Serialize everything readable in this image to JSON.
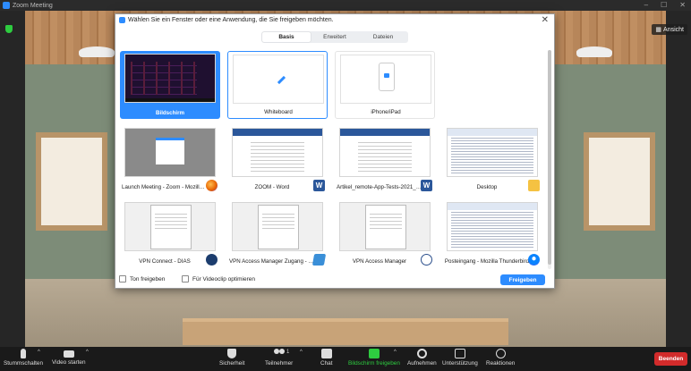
{
  "window": {
    "title": "Zoom Meeting",
    "controls": [
      "–",
      "☐",
      "✕"
    ]
  },
  "view_button": {
    "label": "Ansicht"
  },
  "dialog": {
    "title": "Wählen Sie ein Fenster oder eine Anwendung, die Sie freigeben möchten.",
    "close": "✕",
    "tabs": [
      {
        "label": "Basis",
        "active": true
      },
      {
        "label": "Erweitert",
        "active": false
      },
      {
        "label": "Dateien",
        "active": false
      }
    ],
    "tiles": [
      {
        "label": "Bildschirm",
        "thumb": "screen",
        "state": "selected"
      },
      {
        "label": "Whiteboard",
        "thumb": "whiteboard",
        "state": "outlined"
      },
      {
        "label": "iPhone/iPad",
        "thumb": "iphone",
        "state": "plain"
      },
      {
        "label": "Launch Meeting - Zoom - Mozilla ...",
        "thumb": "browser",
        "badge": "firefox-icon"
      },
      {
        "label": "ZOOM - Word",
        "thumb": "doc",
        "badge": "word-icon"
      },
      {
        "label": "Artikel_remote-App-Tests-2021_0...",
        "thumb": "doc",
        "badge": "word-icon"
      },
      {
        "label": "Desktop",
        "thumb": "desktop",
        "badge": "folder-icon"
      },
      {
        "label": "VPN Connect - DIAS",
        "thumb": "app",
        "badge": "vpn-icon"
      },
      {
        "label": "VPN Access Manager Zugang - E...",
        "thumb": "app",
        "badge": "manager-icon"
      },
      {
        "label": "VPN Access Manager",
        "thumb": "app",
        "badge": "lock-icon"
      },
      {
        "label": "Posteingang - Mozilla Thunderbird",
        "thumb": "desktop",
        "badge": "thunderbird-icon"
      }
    ],
    "footer": {
      "sound_label": "Ton freigeben",
      "video_label": "Für Videoclip optimieren",
      "share_button": "Freigeben"
    }
  },
  "toolbar": {
    "items": [
      {
        "label": "Stummschalten",
        "icon": "mic-icon"
      },
      {
        "label": "Video starten",
        "icon": "camera-icon"
      },
      {
        "label": "Sicherheit",
        "icon": "shield-icon"
      },
      {
        "label": "Teilnehmer",
        "icon": "participants-icon",
        "count": "1"
      },
      {
        "label": "Chat",
        "icon": "chat-icon"
      },
      {
        "label": "Bildschirm freigeben",
        "icon": "share-screen-icon"
      },
      {
        "label": "Aufnehmen",
        "icon": "record-icon"
      },
      {
        "label": "Unterstützung",
        "icon": "support-icon"
      },
      {
        "label": "Reaktionen",
        "icon": "reactions-icon"
      }
    ],
    "end_button": "Beenden"
  },
  "colors": {
    "accent": "#2d8cff",
    "share_green": "#2ecc40",
    "end_red": "#d22b2b"
  }
}
